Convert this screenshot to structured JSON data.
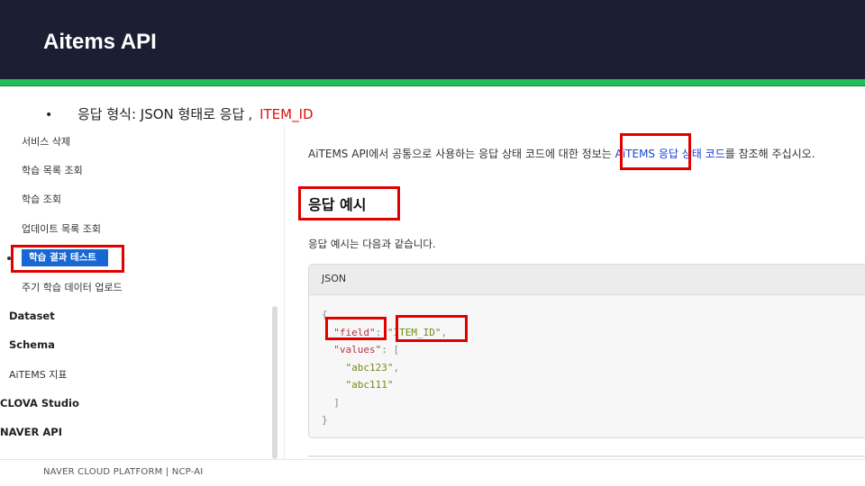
{
  "header": {
    "title": "Aitems API"
  },
  "bullet": {
    "dot": "•",
    "text": "응답 형식: JSON 형태로 응답",
    "separator": ",",
    "highlight": "ITEM_ID"
  },
  "sidebar": {
    "items": [
      {
        "label": "서비스 삭제",
        "level": "sub"
      },
      {
        "label": "학습 목록 조회",
        "level": "sub"
      },
      {
        "label": "학습 조회",
        "level": "sub"
      },
      {
        "label": "업데이트 목록 조회",
        "level": "sub"
      },
      {
        "label": "학습 결과 테스트",
        "level": "sub",
        "active": true
      },
      {
        "label": "주기 학습 데이터 업로드",
        "level": "sub"
      },
      {
        "label": "Dataset",
        "level": "top"
      },
      {
        "label": "Schema",
        "level": "top"
      },
      {
        "label": "AiTEMS 지표",
        "level": "top"
      },
      {
        "label": "CLOVA Studio",
        "level": "top"
      },
      {
        "label": "NAVER API",
        "level": "top"
      }
    ]
  },
  "content": {
    "intro_before": "AiTEMS API에서 공통으로 사용하는 응답 상태 코드에 대한 정보는 ",
    "intro_link": "AiTEMS 응답 상태 코드",
    "intro_after": "를 참조해 주십시오.",
    "heading": "응답 예시",
    "description": "응답 예시는 다음과 같습니다.",
    "code": {
      "language": "JSON",
      "open_brace": "{",
      "field_key": "\"field\"",
      "field_value": "\"ITEM_ID\"",
      "values_key": "\"values\"",
      "values": [
        "\"abc123\"",
        "\"abc111\""
      ],
      "close_bracket": "]",
      "close_brace": "}"
    }
  },
  "footer": {
    "text": "NAVER CLOUD PLATFORM  |  NCP-AI"
  },
  "colors": {
    "header_bg": "#1c1e33",
    "accent": "#1fbe5a",
    "highlight_red": "#e00000",
    "active_blue": "#1967d2",
    "link_blue": "#1a3fd6"
  }
}
